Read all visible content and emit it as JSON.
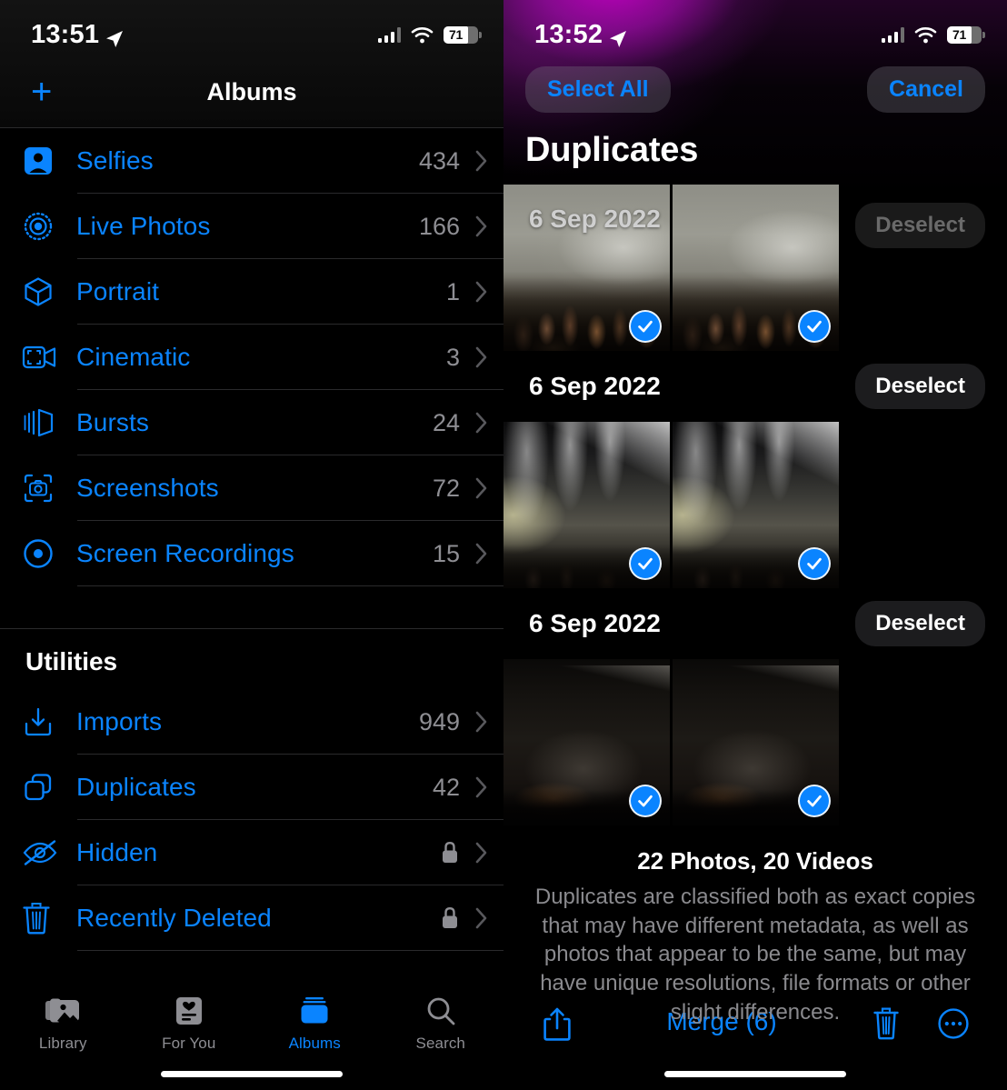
{
  "left": {
    "status": {
      "time": "13:51",
      "battery": "71",
      "location_icon": "location-arrow-icon",
      "signal_icon": "cellular-signal-icon",
      "wifi_icon": "wifi-icon"
    },
    "nav": {
      "add_label": "+",
      "title": "Albums"
    },
    "media_types": [
      {
        "icon": "selfies-icon",
        "label": "Selfies",
        "count": "434"
      },
      {
        "icon": "live-photos-icon",
        "label": "Live Photos",
        "count": "166"
      },
      {
        "icon": "portrait-icon",
        "label": "Portrait",
        "count": "1"
      },
      {
        "icon": "cinematic-icon",
        "label": "Cinematic",
        "count": "3"
      },
      {
        "icon": "bursts-icon",
        "label": "Bursts",
        "count": "24"
      },
      {
        "icon": "screenshots-icon",
        "label": "Screenshots",
        "count": "72"
      },
      {
        "icon": "screen-recordings-icon",
        "label": "Screen Recordings",
        "count": "15"
      }
    ],
    "utilities_header": "Utilities",
    "utilities": [
      {
        "icon": "imports-icon",
        "label": "Imports",
        "count": "949",
        "locked": false
      },
      {
        "icon": "duplicates-icon",
        "label": "Duplicates",
        "count": "42",
        "locked": false
      },
      {
        "icon": "hidden-icon",
        "label": "Hidden",
        "count": "",
        "locked": true
      },
      {
        "icon": "recently-deleted-icon",
        "label": "Recently Deleted",
        "count": "",
        "locked": true
      }
    ],
    "tabs": [
      {
        "icon": "library-icon",
        "label": "Library",
        "active": false
      },
      {
        "icon": "for-you-icon",
        "label": "For You",
        "active": false
      },
      {
        "icon": "albums-icon",
        "label": "Albums",
        "active": true
      },
      {
        "icon": "search-icon",
        "label": "Search",
        "active": false
      }
    ]
  },
  "right": {
    "status": {
      "time": "13:52",
      "battery": "71",
      "location_icon": "location-arrow-icon",
      "signal_icon": "cellular-signal-icon",
      "wifi_icon": "wifi-icon"
    },
    "select_all_label": "Select All",
    "cancel_label": "Cancel",
    "title": "Duplicates",
    "groups": [
      {
        "date": "6 Sep 2022",
        "deselect_label": "Deselect",
        "thumbs": [
          {
            "selected": true
          },
          {
            "selected": true
          }
        ]
      },
      {
        "date": "6 Sep 2022",
        "deselect_label": "Deselect",
        "thumbs": [
          {
            "selected": true
          },
          {
            "selected": true
          }
        ]
      },
      {
        "date": "6 Sep 2022",
        "deselect_label": "Deselect",
        "thumbs": [
          {
            "selected": true
          },
          {
            "selected": true
          }
        ]
      }
    ],
    "footer_count": "22 Photos, 20 Videos",
    "footer_desc": "Duplicates are classified both as exact copies that may have different metadata, as well as photos that appear to be the same, but may have unique resolutions, file formats or other slight differences.",
    "toolbar": {
      "share_icon": "share-icon",
      "merge_label": "Merge (6)",
      "trash_icon": "trash-icon",
      "more_icon": "more-circle-icon"
    }
  },
  "colors": {
    "accent": "#0a84ff",
    "secondary_text": "#8e8e93",
    "separator": "#2a2a2c",
    "background": "#000000"
  }
}
